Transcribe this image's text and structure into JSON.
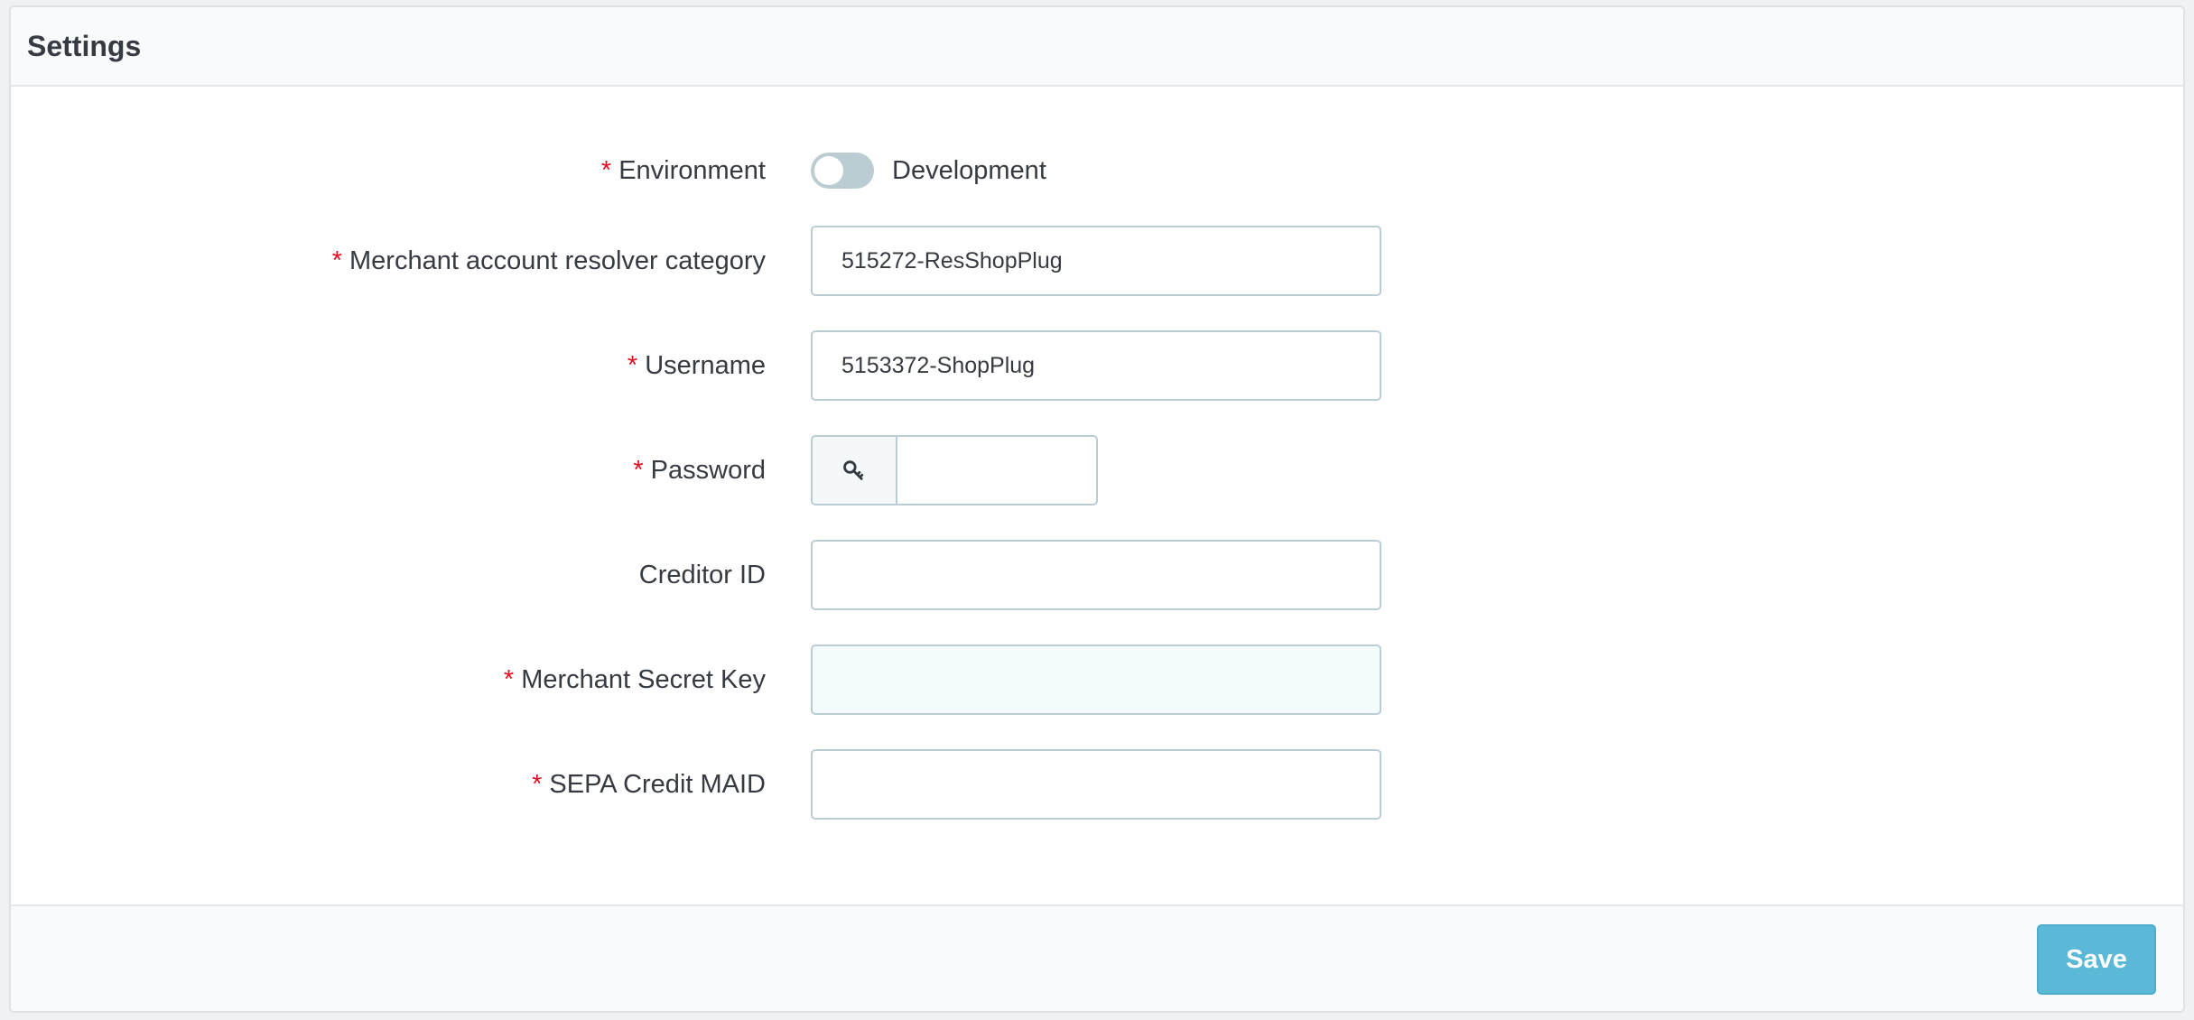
{
  "panel": {
    "title": "Settings"
  },
  "form": {
    "environment": {
      "label": "Environment",
      "required": "*",
      "toggle_state": "off",
      "value_label": "Development"
    },
    "merchant_category": {
      "label": "Merchant account resolver category",
      "required": "*",
      "value": "515272-ResShopPlug"
    },
    "username": {
      "label": "Username",
      "required": "*",
      "value": "5153372-ShopPlug"
    },
    "password": {
      "label": "Password",
      "required": "*",
      "value": "",
      "icon": "key-icon"
    },
    "creditor_id": {
      "label": "Creditor ID",
      "value": ""
    },
    "merchant_secret_key": {
      "label": "Merchant Secret Key",
      "required": "*",
      "value": ""
    },
    "sepa_credit_maid": {
      "label": "SEPA Credit MAID",
      "required": "*",
      "value": ""
    }
  },
  "footer": {
    "save_label": "Save"
  },
  "colors": {
    "required": "#e10f21",
    "save_button": "#5bb8d6",
    "input_border": "#bbcdd2",
    "toggle_off": "#bbcdd2",
    "text": "#363a41"
  }
}
